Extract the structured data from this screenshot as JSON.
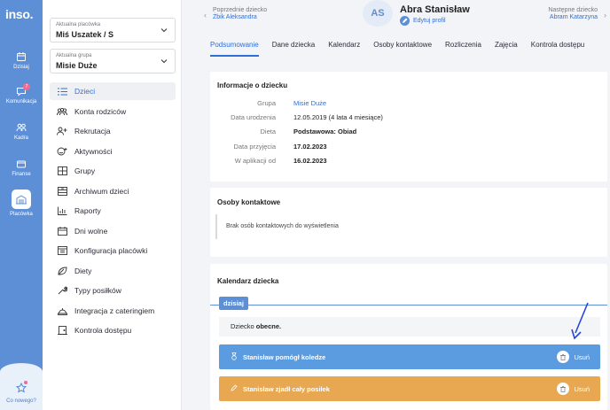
{
  "rail": {
    "logo": "inso.",
    "items": [
      {
        "label": "Dzisiaj",
        "icon": "calendar-icon"
      },
      {
        "label": "Komunikacja",
        "icon": "chat-icon",
        "badge": "7"
      },
      {
        "label": "Kadra",
        "icon": "people-icon"
      },
      {
        "label": "Finanse",
        "icon": "wallet-icon"
      },
      {
        "label": "Placówka",
        "icon": "building-icon"
      }
    ],
    "bottom_label": "Co nowego?"
  },
  "sidebar": {
    "facility_label": "Aktualna placówka",
    "facility_value": "Miś Uszatek / S",
    "group_label": "Aktualna grupa",
    "group_value": "Misie Duże",
    "items": [
      {
        "label": "Dzieci",
        "icon": "list-icon"
      },
      {
        "label": "Konta rodziców",
        "icon": "users-icon"
      },
      {
        "label": "Rekrutacja",
        "icon": "user-plus-icon"
      },
      {
        "label": "Aktywności",
        "icon": "smile-icon"
      },
      {
        "label": "Grupy",
        "icon": "grid-icon"
      },
      {
        "label": "Archiwum dzieci",
        "icon": "archive-icon"
      },
      {
        "label": "Raporty",
        "icon": "chart-icon"
      },
      {
        "label": "Dni wolne",
        "icon": "calendar-off-icon"
      },
      {
        "label": "Konfiguracja placówki",
        "icon": "config-icon"
      },
      {
        "label": "Diety",
        "icon": "leaf-icon"
      },
      {
        "label": "Typy posiłków",
        "icon": "wrench-icon"
      },
      {
        "label": "Integracja z cateringiem",
        "icon": "catering-icon"
      },
      {
        "label": "Kontrola dostępu",
        "icon": "door-icon"
      }
    ]
  },
  "header": {
    "prev_label": "Poprzednie dziecko",
    "prev_name": "Żbik Aleksandra",
    "avatar_initials": "AS",
    "child_name": "Abra Stanisław",
    "edit_label": "Edytuj profil",
    "next_label": "Następne dziecko",
    "next_name": "Abram Katarzyna"
  },
  "tabs": [
    "Podsumowanie",
    "Dane dziecka",
    "Kalendarz",
    "Osoby kontaktowe",
    "Rozliczenia",
    "Zajęcia",
    "Kontrola dostępu"
  ],
  "info": {
    "title": "Informacje o dziecku",
    "rows": [
      {
        "key": "Grupa",
        "value": "Misie Duże"
      },
      {
        "key": "Data urodzenia",
        "value": "12.05.2019 (4 lata 4 miesiące)"
      },
      {
        "key": "Dieta",
        "value": "Podstawowa: Obiad"
      },
      {
        "key": "Data przyjęcia",
        "value": "17.02.2023"
      },
      {
        "key": "W aplikacji od",
        "value": "16.02.2023"
      }
    ]
  },
  "contacts": {
    "title": "Osoby kontaktowe",
    "empty": "Brak osób kontaktowych do wyświetlenia"
  },
  "calendar": {
    "title": "Kalendarz dziecka",
    "today": "dzisiaj",
    "status_prefix": "Dziecko ",
    "status_bold": "obecne.",
    "events": [
      {
        "text": "Stanisław pomógł koledze",
        "delete": "Usuń",
        "color": "#5b9be0"
      },
      {
        "text": "Stanisław zjadł cały posiłek",
        "delete": "Usuń",
        "color": "#e8a751"
      }
    ]
  },
  "colors": {
    "accent": "#2f6fd8",
    "rail": "#5d8fd6",
    "annotation_arrow": "#2348d6"
  }
}
